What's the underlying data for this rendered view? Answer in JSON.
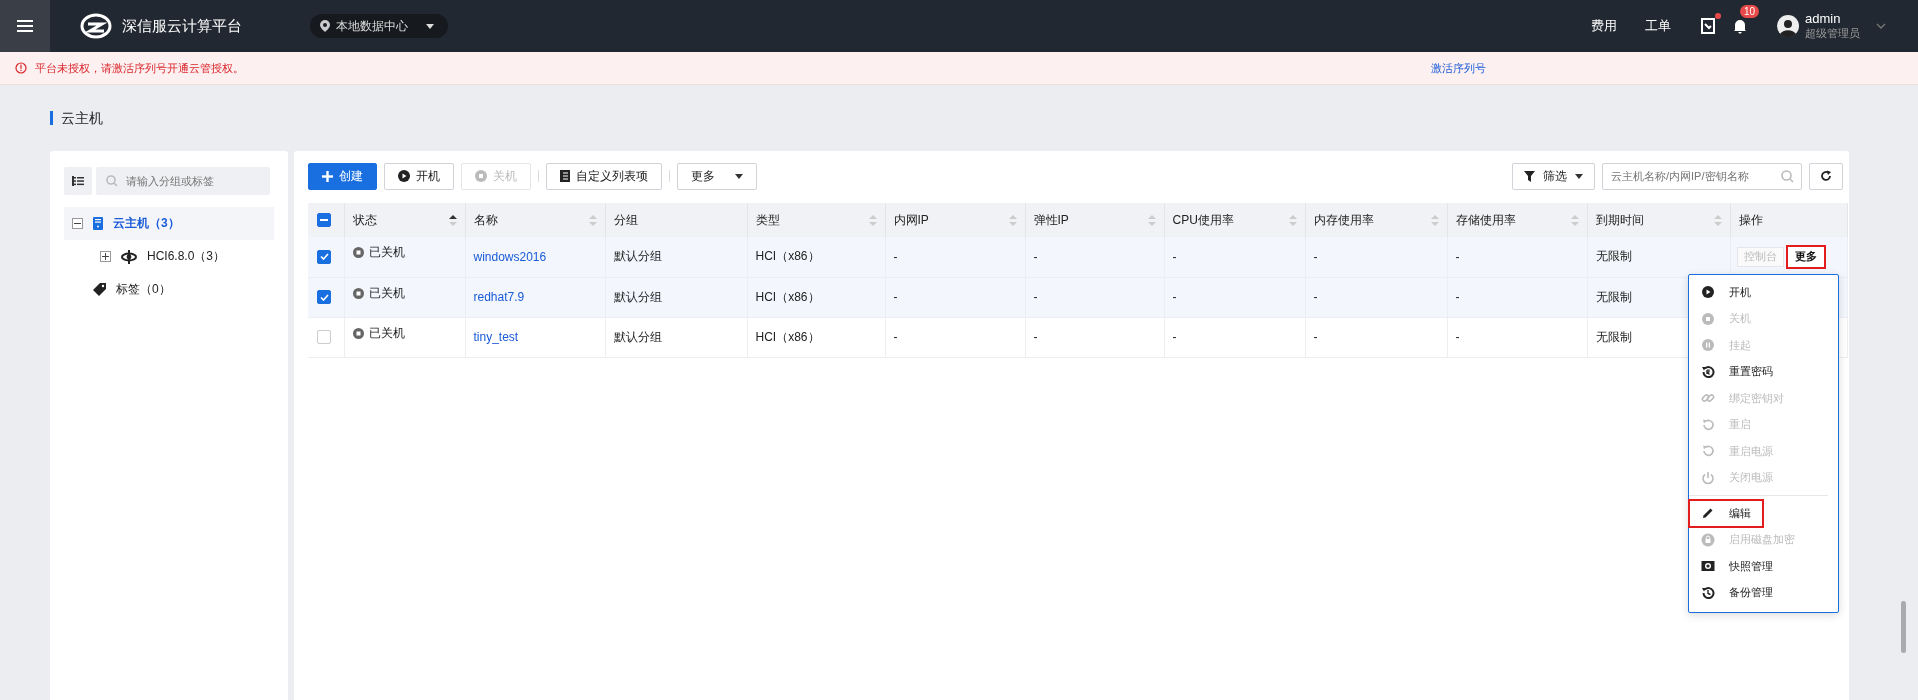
{
  "topbar": {
    "product": "深信服云计算平台",
    "datacenter": "本地数据中心",
    "links": [
      "费用",
      "工单"
    ],
    "report_dot": true,
    "bell_badge": "10",
    "user": {
      "name": "admin",
      "role": "超级管理员"
    }
  },
  "alert": {
    "message": "平台未授权，请激活序列号开通云管授权。",
    "action": "激活序列号"
  },
  "page_title": "云主机",
  "tree": {
    "search_placeholder": "请输入分组或标签",
    "items": [
      {
        "kind": "host",
        "label": "云主机（3）",
        "selected": true,
        "expanded": true,
        "children": [
          {
            "kind": "cluster",
            "label": "HCI6.8.0（3）",
            "selected": false,
            "expanded": false
          }
        ]
      },
      {
        "kind": "tag",
        "label": "标签（0）",
        "selected": false
      }
    ]
  },
  "toolbar": {
    "buttons": [
      {
        "kind": "create",
        "label": "创建",
        "disabled": false
      },
      {
        "kind": "start",
        "label": "开机",
        "disabled": false
      },
      {
        "kind": "stop",
        "label": "关机",
        "disabled": true
      },
      {
        "kind": "columns",
        "label": "自定义列表项",
        "disabled": false
      },
      {
        "kind": "more",
        "label": "更多",
        "disabled": false
      }
    ],
    "filter": "筛选",
    "search_placeholder": "云主机名称/内网IP/密钥名称"
  },
  "table": {
    "some_selected": true,
    "columns": [
      {
        "label": "状态",
        "sortable": true
      },
      {
        "label": "名称",
        "sortable": true
      },
      {
        "label": "分组",
        "sortable": false
      },
      {
        "label": "类型",
        "sortable": true
      },
      {
        "label": "内网IP",
        "sortable": true
      },
      {
        "label": "弹性IP",
        "sortable": true
      },
      {
        "label": "CPU使用率",
        "sortable": true
      },
      {
        "label": "内存使用率",
        "sortable": true
      },
      {
        "label": "存储使用率",
        "sortable": true
      },
      {
        "label": "到期时间",
        "sortable": true
      },
      {
        "label": "操作",
        "sortable": false
      }
    ],
    "rows": [
      {
        "selected": true,
        "status": "已关机",
        "name": "windows2016",
        "group": "默认分组",
        "type": "HCI（x86）",
        "ip": "-",
        "eip": "-",
        "cpu": "-",
        "mem": "-",
        "storage": "-",
        "expiry": "无限制",
        "actions": [
          {
            "kind": "console",
            "label": "控制台",
            "disabled": true,
            "highlighted": false
          },
          {
            "kind": "more",
            "label": "更多",
            "disabled": false,
            "highlighted": true
          }
        ]
      },
      {
        "selected": true,
        "status": "已关机",
        "name": "redhat7.9",
        "group": "默认分组",
        "type": "HCI（x86）",
        "ip": "-",
        "eip": "-",
        "cpu": "-",
        "mem": "-",
        "storage": "-",
        "expiry": "无限制"
      },
      {
        "selected": false,
        "status": "已关机",
        "name": "tiny_test",
        "group": "默认分组",
        "type": "HCI（x86）",
        "ip": "-",
        "eip": "-",
        "cpu": "-",
        "mem": "-",
        "storage": "-",
        "expiry": "无限制"
      }
    ]
  },
  "menu": {
    "items": [
      {
        "kind": "play",
        "label": "开机",
        "disabled": false,
        "highlighted": false
      },
      {
        "kind": "stop",
        "label": "关机",
        "disabled": true,
        "highlighted": false
      },
      {
        "kind": "pause",
        "label": "挂起",
        "disabled": true,
        "highlighted": false
      },
      {
        "kind": "reset",
        "label": "重置密码",
        "disabled": false,
        "highlighted": false
      },
      {
        "kind": "link",
        "label": "绑定密钥对",
        "disabled": true,
        "highlighted": false
      },
      {
        "kind": "restart",
        "label": "重启",
        "disabled": true,
        "highlighted": false
      },
      {
        "kind": "restart",
        "label": "重启电源",
        "disabled": true,
        "highlighted": false
      },
      {
        "kind": "power",
        "label": "关闭电源",
        "disabled": true,
        "highlighted": false
      },
      {
        "kind": "divider"
      },
      {
        "kind": "edit",
        "label": "编辑",
        "disabled": false,
        "highlighted": true
      },
      {
        "kind": "lock",
        "label": "启用磁盘加密",
        "disabled": true,
        "highlighted": false
      },
      {
        "kind": "camera",
        "label": "快照管理",
        "disabled": false,
        "highlighted": false
      },
      {
        "kind": "history",
        "label": "备份管理",
        "disabled": false,
        "highlighted": false
      }
    ]
  }
}
